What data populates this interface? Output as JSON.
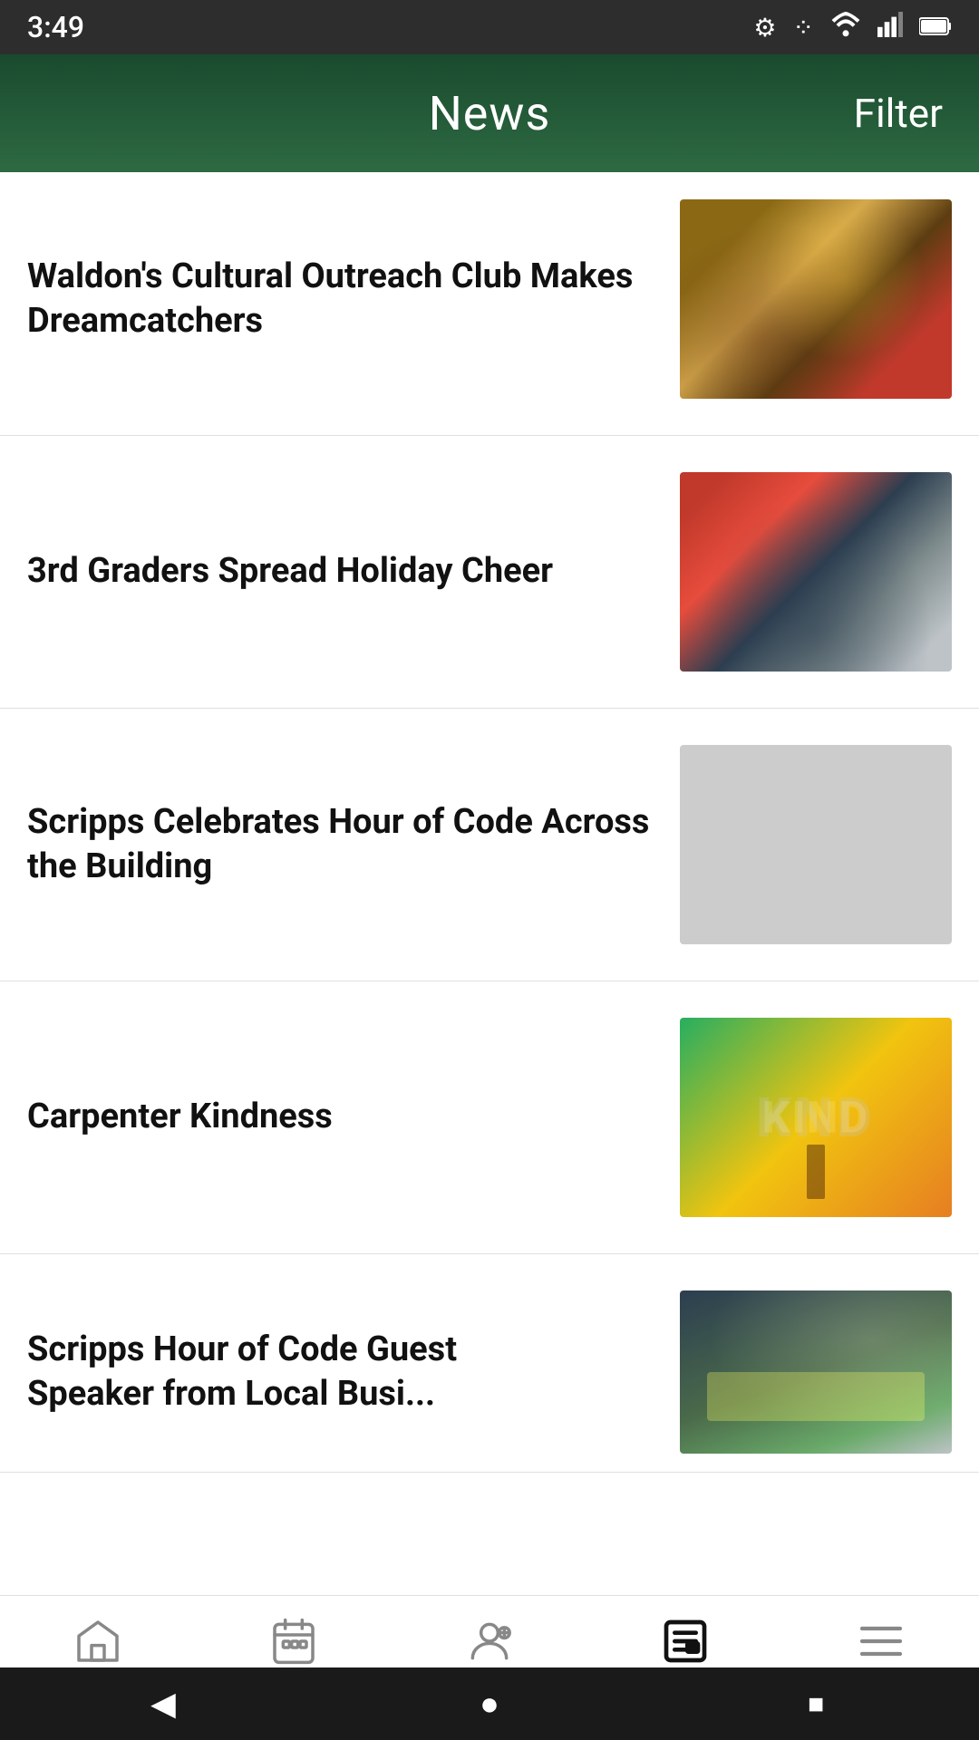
{
  "statusBar": {
    "time": "3:49",
    "icons": [
      "settings",
      "dots",
      "wifi",
      "signal",
      "battery"
    ]
  },
  "header": {
    "title": "News",
    "filterLabel": "Filter"
  },
  "newsList": {
    "items": [
      {
        "id": 1,
        "headline": "Waldon's Cultural Outreach Club Makes Dreamcatchers",
        "imageClass": "img-dreamcatchers"
      },
      {
        "id": 2,
        "headline": "3rd Graders Spread Holiday Cheer",
        "imageClass": "img-holiday"
      },
      {
        "id": 3,
        "headline": "Scripps Celebrates Hour of Code Across the Building",
        "imageClass": "img-hourcode"
      },
      {
        "id": 4,
        "headline": "Carpenter Kindness",
        "imageClass": "img-kindness"
      },
      {
        "id": 5,
        "headline": "Scripps Hour of Code Guest Speaker from Local Busi...",
        "imageClass": "img-guestspeaker"
      }
    ]
  },
  "bottomNav": {
    "items": [
      {
        "id": "home",
        "label": "Home",
        "active": false
      },
      {
        "id": "events",
        "label": "Events",
        "active": false
      },
      {
        "id": "directory",
        "label": "Directory",
        "active": false
      },
      {
        "id": "news",
        "label": "News",
        "active": true
      },
      {
        "id": "more",
        "label": "More",
        "active": false
      }
    ]
  },
  "androidNav": {
    "back": "◀",
    "home": "●",
    "recent": "■"
  }
}
